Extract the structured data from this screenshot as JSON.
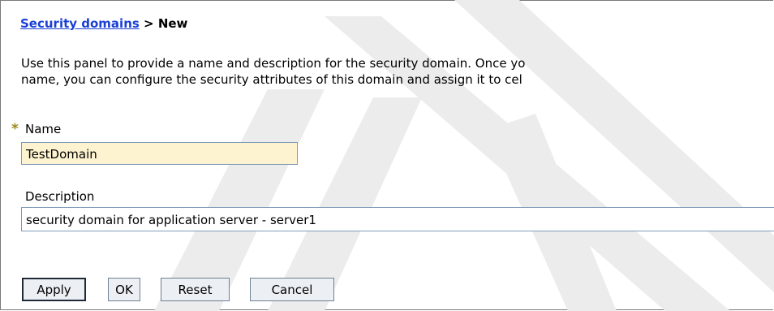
{
  "breadcrumb": {
    "link": "Security domains",
    "separator": " > ",
    "current": "New"
  },
  "description_lines": [
    "Use this panel to provide a name and description for the security domain. Once yo",
    "name, you can configure the security attributes of this domain and assign it to cel"
  ],
  "form": {
    "required_marker": "*",
    "name_label": "Name",
    "name_value": "TestDomain",
    "description_label": "Description",
    "description_value": "security domain for application server - server1"
  },
  "buttons": {
    "apply": "Apply",
    "ok": "OK",
    "reset": "Reset",
    "cancel": "Cancel"
  },
  "colors": {
    "link": "#1a3fd6",
    "required_star": "#9c8a1e",
    "name_field_bg": "#fdf3d0",
    "watermark": "#e6e6e6"
  }
}
